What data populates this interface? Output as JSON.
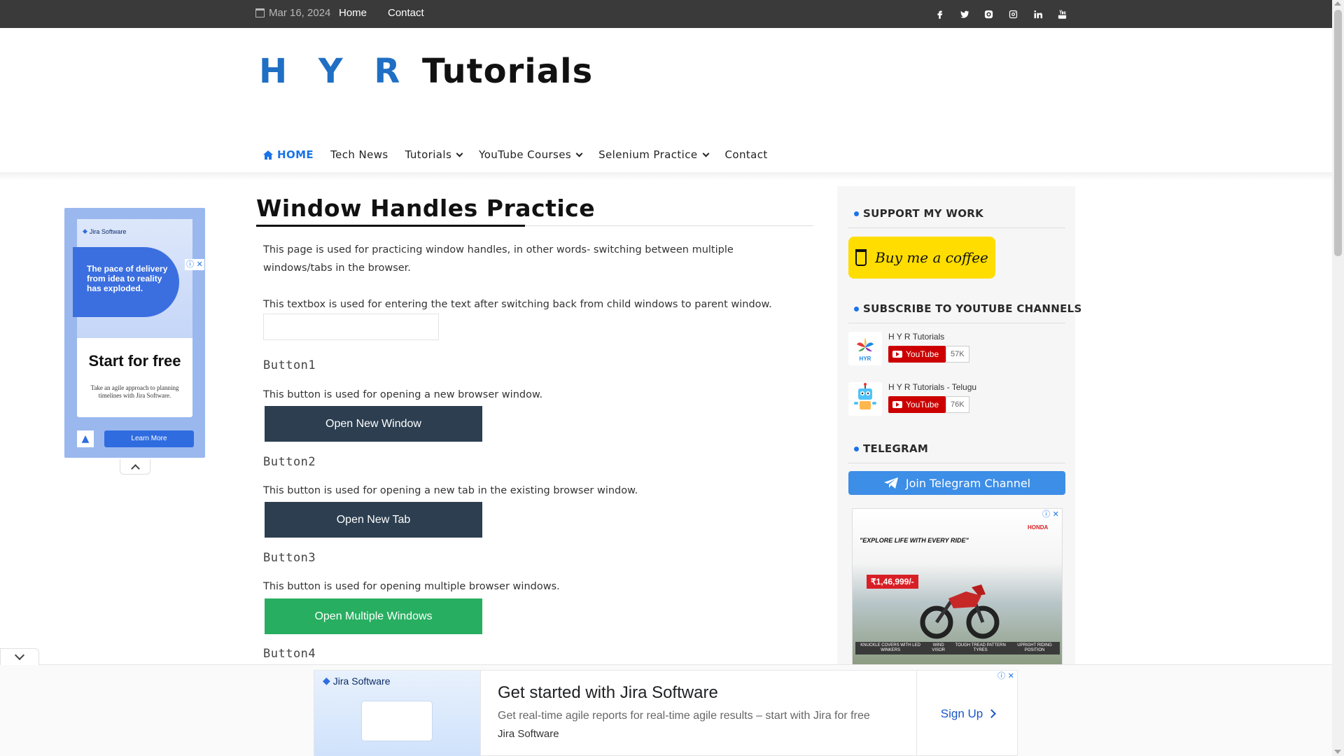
{
  "topbar": {
    "date": "Mar 16, 2024",
    "links": [
      "Home",
      "Contact"
    ],
    "social_icons": [
      "facebook-icon",
      "twitter-icon",
      "skype-icon",
      "instagram-icon",
      "linkedin-icon",
      "youtube-icon"
    ]
  },
  "logo": {
    "part1": "H Y R",
    "part2": "Tutorials"
  },
  "nav": {
    "items": [
      {
        "label": "HOME",
        "active": true
      },
      {
        "label": "Tech News"
      },
      {
        "label": "Tutorials",
        "dropdown": true
      },
      {
        "label": "YouTube Courses",
        "dropdown": true
      },
      {
        "label": "Selenium Practice",
        "dropdown": true
      },
      {
        "label": "Contact"
      }
    ]
  },
  "left_ad": {
    "brand": "Jira Software",
    "quote": "The pace of delivery from idea to reality has exploded.",
    "headline": "Start for free",
    "sub": "Take an agile approach to planning timelines with Jira Software.",
    "cta": "Learn More"
  },
  "main": {
    "title": "Window Handles Practice",
    "intro": "This page is used for practicing window handles, in other words- switching between multiple windows/tabs in the browser.",
    "textbox_desc": "This textbox is used for entering the text after switching back from child windows to parent window.",
    "textbox_value": "",
    "sections": [
      {
        "heading": "Button1",
        "desc": "This button is used for opening a new browser window.",
        "button": "Open New Window"
      },
      {
        "heading": "Button2",
        "desc": "This button is used for opening a new tab in the existing browser window.",
        "button": "Open New Tab"
      },
      {
        "heading": "Button3",
        "desc": "This button is used for opening multiple browser windows.",
        "button": "Open Multiple Windows"
      },
      {
        "heading": "Button4"
      }
    ]
  },
  "sidebar": {
    "support_title": "SUPPORT MY WORK",
    "coffee_label": "Buy me a coffee",
    "subscribe_title": "SUBSCRIBE TO YOUTUBE CHANNELS",
    "channels": [
      {
        "name": "H Y R Tutorials",
        "button": "YouTube",
        "count": "57K"
      },
      {
        "name": "H Y R Tutorials - Telugu",
        "button": "YouTube",
        "count": "76K"
      }
    ],
    "telegram_title": "TELEGRAM",
    "telegram_button": "Join Telegram Channel",
    "ad": {
      "price": "₹1,46,999/-",
      "brand": "HONDA",
      "tagline": "\"EXPLORE LIFE WITH EVERY RIDE\"",
      "features": [
        "KNUCKLE COVERS WITH LED WINKERS",
        "WIND VISOR",
        "TOUGH TREAD PATTERN TYRES",
        "UPRIGHT RIDING POSITION"
      ]
    }
  },
  "bottom_ad": {
    "brand": "Jira Software",
    "title": "Get started with Jira Software",
    "desc": "Get real-time agile reports for real-time agile results – start with Jira for free",
    "advertiser": "Jira Software",
    "cta": "Sign Up"
  },
  "colors": {
    "accent": "#1a73e8",
    "button_dark": "#2c3e50",
    "button_green": "#27ae60",
    "topbar": "#3a3a3a",
    "coffee": "#ffdd00",
    "telegram": "#3d8ee6"
  }
}
